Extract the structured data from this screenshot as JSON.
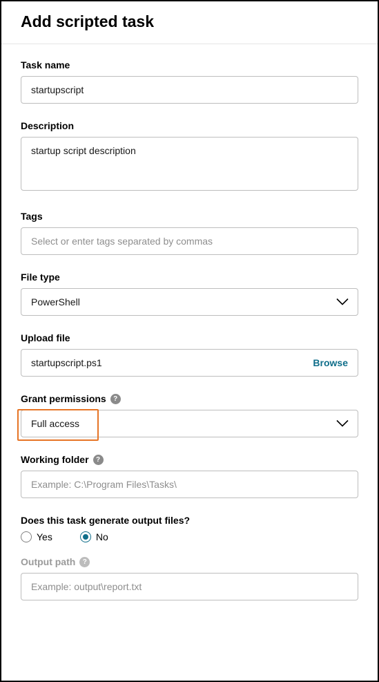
{
  "header": {
    "title": "Add scripted task"
  },
  "task_name": {
    "label": "Task name",
    "value": "startupscript"
  },
  "description": {
    "label": "Description",
    "value": "startup script description"
  },
  "tags": {
    "label": "Tags",
    "placeholder": "Select or enter tags separated by commas"
  },
  "file_type": {
    "label": "File type",
    "value": "PowerShell"
  },
  "upload": {
    "label": "Upload file",
    "filename": "startupscript.ps1",
    "browse": "Browse"
  },
  "grant": {
    "label": "Grant permissions",
    "value": "Full access"
  },
  "working_folder": {
    "label": "Working folder",
    "placeholder": "Example: C:\\Program Files\\Tasks\\"
  },
  "generate_output": {
    "label": "Does this task generate output files?",
    "yes": "Yes",
    "no": "No",
    "selected": "No"
  },
  "output_path": {
    "label": "Output path",
    "placeholder": "Example: output\\report.txt"
  },
  "help_glyph": "?"
}
